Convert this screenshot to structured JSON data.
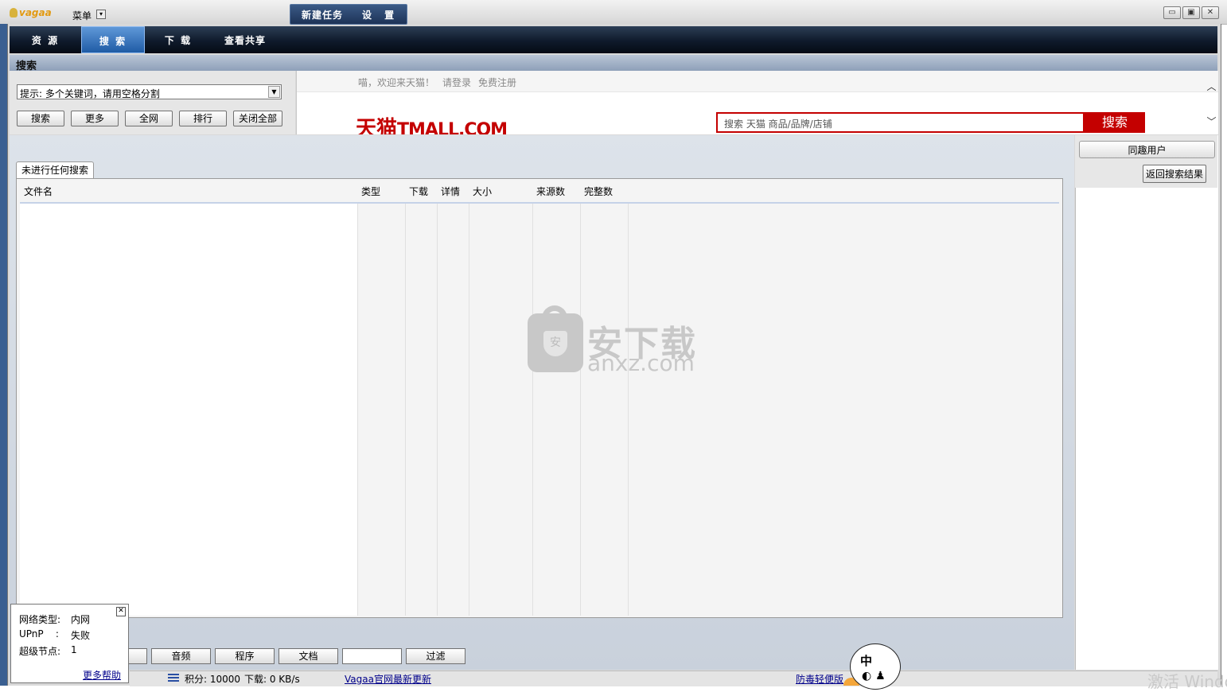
{
  "window": {
    "logo_text": "vagaa",
    "menu_label": "菜单",
    "buttons": [
      "▭",
      "▣",
      "✕"
    ]
  },
  "nav": {
    "tabs": [
      "资 源",
      "搜 索",
      "下 载",
      "查看共享"
    ],
    "active": "搜 索",
    "group": [
      "新建任务",
      "设 置"
    ]
  },
  "section_title": "搜索",
  "search_panel": {
    "keyword_hint": "提示: 多个关键词，请用空格分割",
    "buttons": [
      "搜索",
      "更多",
      "全网",
      "排行",
      "关闭全部"
    ]
  },
  "ad": {
    "welcome": "喵，欢迎来天猫！",
    "login": "请登录",
    "register": "免费注册",
    "logo_cn": "天猫",
    "logo_en": "TMALL.COM",
    "search_placeholder": "搜索 天猫 商品/品牌/店铺",
    "search_button": "搜索"
  },
  "results": {
    "tab_label": "未进行任何搜索",
    "columns": [
      "文件名",
      "类型",
      "下载",
      "详情",
      "大小",
      "来源数",
      "完整数"
    ]
  },
  "right_panel": {
    "fav_users": "同趣用户",
    "back_button": "返回搜索结果"
  },
  "watermark": {
    "cn": "安下载",
    "en": "anxz.com",
    "shield": "安"
  },
  "filters": {
    "buttons": [
      "音频",
      "程序",
      "文档",
      "过滤"
    ]
  },
  "network": {
    "rows": [
      {
        "label": "网络类型:",
        "value": "内网"
      },
      {
        "label": "UPnP    :",
        "value": "失败"
      },
      {
        "label": "超级节点:",
        "value": "1"
      }
    ],
    "help": "更多帮助"
  },
  "status": {
    "points": "积分: 10000",
    "download": "下载: 0 KB/s",
    "update_link": "Vagaa官网最新更新",
    "antivirus_link": "防毒轻便版",
    "bubble_text": "中",
    "win_watermark": "激活 Windo"
  }
}
